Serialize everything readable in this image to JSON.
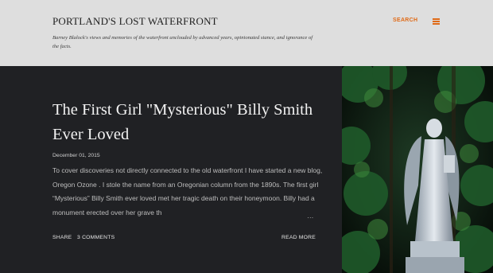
{
  "header": {
    "site_title": "PORTLAND'S LOST WATERFRONT",
    "tagline": "Barney Blalock's views and memories of the waterfront unclouded by advanced years, opinionated stance, and ignorance of the facts.",
    "search_label": "SEARCH",
    "menu_icon": "hamburger-menu-icon"
  },
  "post": {
    "title": "The First Girl \"Mysterious\" Billy Smith Ever Loved",
    "date": "December 01, 2015",
    "snippet": "To cover discoveries not directly connected to the old waterfront I have started a new blog, Oregon Ozone . I stole the name from an Oregonian column from the 1890s. The first girl “Mysterious” Billy Smith ever loved met her tragic death on their honeymoon. Billy had a monument erected over her grave th",
    "ellipsis": "…",
    "share_label": "SHARE",
    "comments_label": "3 COMMENTS",
    "read_more_label": "READ MORE"
  },
  "colors": {
    "accent": "#e06a16",
    "header_bg": "#dedede",
    "body_bg": "#202124"
  }
}
